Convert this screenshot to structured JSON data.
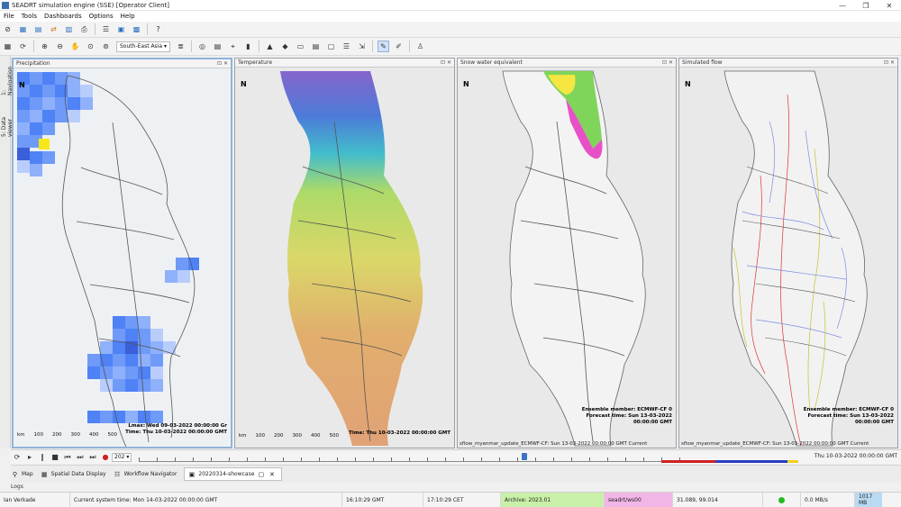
{
  "window": {
    "title": "SEADRT simulation engine (SSE) [Operator Client]",
    "controls": [
      "—",
      "❐",
      "✕"
    ]
  },
  "menu": [
    "File",
    "Tools",
    "Dashboards",
    "Options",
    "Help"
  ],
  "toolbar": {
    "region": "South-East Asia",
    "region_arrow": "▾"
  },
  "sidebar": {
    "navigation": "1: Navigation panel",
    "data": "5: Data viewer"
  },
  "panels": [
    {
      "title": "Precipitation",
      "info_lines": [
        "Lmax: Wed 09-03-2022 00:00:00 Gr",
        "Time: Thu 10-03-2022 00:00:00 GMT"
      ],
      "footer": ""
    },
    {
      "title": "Temperature",
      "info_lines": [
        "Time: Thu 10-03-2022 00:00:00 GMT"
      ],
      "footer": ""
    },
    {
      "title": "Snow water equivalent",
      "info_lines": [
        "Ensemble member: ECMWF-CF 0",
        "Forecast time: Sun 13-03-2022",
        "00:00:00 GMT"
      ],
      "footer": "sflow_myanmar_update_ECMWF-CF: Sun 13-03-2022 00:00:00 GMT Current"
    },
    {
      "title": "Simulated flow",
      "info_lines": [
        "Ensemble member: ECMWF-CF 0",
        "Forecast time: Sun 13-03-2022",
        "00:00:00 GMT"
      ],
      "footer": "sflow_myanmar_update_ECMWF-CF: Sun 13-03-2022 00:00:00 GMT Current"
    }
  ],
  "panel_controls": "⊡ ✕",
  "scale": {
    "unit": "km",
    "labels": [
      "100",
      "200",
      "300",
      "400",
      "500"
    ]
  },
  "timebar": {
    "relative": "202",
    "current": "Thu 10-03-2022 00:00:00 GMT"
  },
  "tabs": [
    {
      "label": "Map",
      "icon": "map-icon"
    },
    {
      "label": "Spatial Data Display",
      "icon": "spatial-display-icon"
    },
    {
      "label": "Workflow Navigator",
      "icon": "workflow-icon"
    },
    {
      "label": "20220314-showcase",
      "icon": "showcase-icon"
    }
  ],
  "logs_label": "Logs",
  "status": {
    "user": "Ian Verkade",
    "system_time": "Current system time: Mon 14-03-2022 00:00:00 GMT",
    "time_gmt": "16:10:29 GMT",
    "time_cet": "17:10:29 CET",
    "archive": "Archive: 2023.01",
    "server": "seadrt/ws00",
    "coords": "31.089, 99.014",
    "rate": "0.0 MB/s",
    "memory": "1017 MB",
    "colors": {
      "archive": "#c9f0a8",
      "server": "#f2b6e6",
      "memory": "#b9daf3",
      "ok": "#22bb22"
    }
  }
}
